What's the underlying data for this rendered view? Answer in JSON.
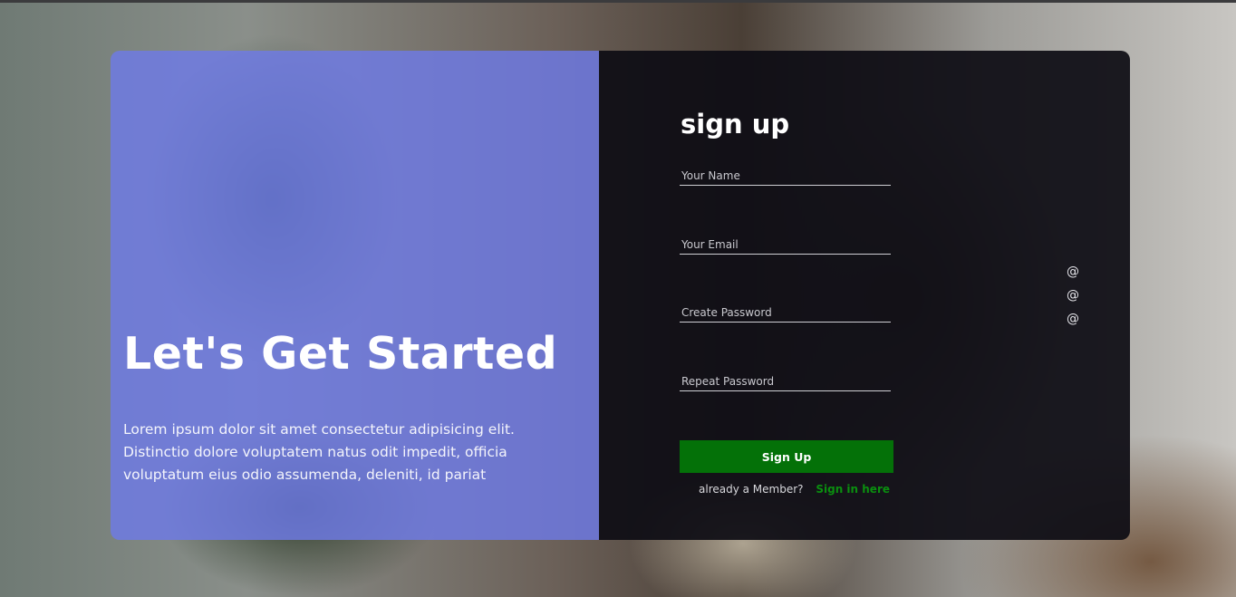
{
  "hero": {
    "title": "Let's Get Started",
    "text": "Lorem ipsum dolor sit amet consectetur adipisicing elit. Distinctio dolore voluptatem natus odit impedit, officia voluptatum eius odio assumenda, deleniti, id pariat"
  },
  "form": {
    "title": "sign up",
    "name_placeholder": "Your Name",
    "email_placeholder": "Your Email",
    "password_placeholder": "Create Password",
    "repeat_placeholder": "Repeat Password",
    "submit_label": "Sign Up",
    "member_text": "already a Member?",
    "signin_label": "Sign in here"
  },
  "social": {
    "items": [
      {
        "glyph": "@",
        "icon": "at-icon"
      },
      {
        "glyph": "@",
        "icon": "at-icon"
      },
      {
        "glyph": "@",
        "icon": "at-icon"
      }
    ]
  },
  "colors": {
    "left_panel": "#6e7ae6",
    "right_panel": "#0e0d14",
    "button": "#047108",
    "link": "#0a8f0f"
  }
}
